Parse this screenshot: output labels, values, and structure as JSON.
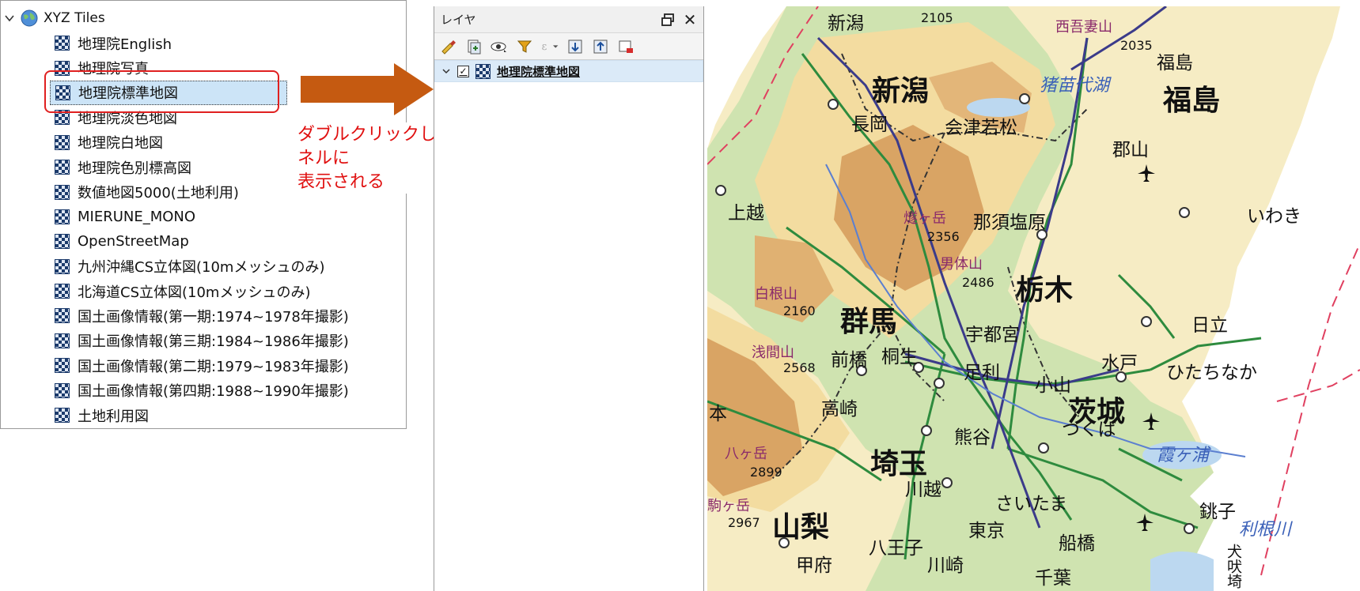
{
  "browser": {
    "root_label": "XYZ Tiles",
    "items": [
      {
        "label": "地理院English"
      },
      {
        "label": "地理院写真"
      },
      {
        "label": "地理院標準地図",
        "selected": true
      },
      {
        "label": "地理院淡色地図"
      },
      {
        "label": "地理院白地図"
      },
      {
        "label": "地理院色別標高図"
      },
      {
        "label": "数値地図5000(土地利用)"
      },
      {
        "label": "MIERUNE_MONO"
      },
      {
        "label": "OpenStreetMap"
      },
      {
        "label": "九州沖縄CS立体図(10mメッシュのみ)"
      },
      {
        "label": "北海道CS立体図(10mメッシュのみ)"
      },
      {
        "label": "国土画像情報(第一期:1974~1978年撮影)"
      },
      {
        "label": "国土画像情報(第三期:1984~1986年撮影)"
      },
      {
        "label": "国土画像情報(第二期:1979~1983年撮影)"
      },
      {
        "label": "国土画像情報(第四期:1988~1990年撮影)"
      },
      {
        "label": "土地利用図"
      }
    ]
  },
  "callout": {
    "line1": "ダブルクリックしたタイルが、レイヤパネルに",
    "line2": "表示される",
    "color": "#e01010",
    "arrow_color": "#c55a11"
  },
  "layers_panel": {
    "title": "レイヤ",
    "toolbar_icons": [
      "style-icon",
      "add-group-icon",
      "visibility-icon",
      "filter-icon",
      "expression-filter-icon",
      "expand-all-icon",
      "collapse-all-icon",
      "remove-layer-icon"
    ],
    "layers": [
      {
        "name": "地理院標準地図",
        "checked": true
      }
    ]
  },
  "map": {
    "prefectures": [
      "新潟",
      "福島",
      "群馬",
      "栃木",
      "茨城",
      "埼玉",
      "山梨"
    ],
    "cities": [
      "新潟",
      "長岡",
      "会津若松",
      "福島",
      "郡山",
      "上越",
      "那須塩原",
      "いわき",
      "宇都宮",
      "日立",
      "前橋",
      "桐生",
      "足利",
      "水戸",
      "ひたちなか",
      "高崎",
      "小山",
      "熊谷",
      "つくば",
      "川越",
      "さいたま",
      "東京",
      "船橋",
      "銚子",
      "甲府",
      "八王子",
      "川崎",
      "千葉",
      "本"
    ],
    "mountains": [
      {
        "name": "西吾妻山",
        "elev": "2035"
      },
      {
        "name": "燧ヶ岳",
        "elev": "2356"
      },
      {
        "name": "男体山",
        "elev": "2486"
      },
      {
        "name": "白根山",
        "elev": "2160"
      },
      {
        "name": "浅間山",
        "elev": "2568"
      },
      {
        "name": "八ヶ岳",
        "elev": "2899"
      },
      {
        "name": "駒ヶ岳",
        "elev": "2967"
      }
    ],
    "top_elev": "2105",
    "water": [
      "猪苗代湖",
      "霞ヶ浦",
      "利根川"
    ],
    "coast_label": "犬吠埼",
    "partial_label": "東京",
    "colors": {
      "lowland": "#cfe3b0",
      "upland": "#f3dca0",
      "mountain": "#d9a464",
      "sea": "#ffffff",
      "road": "#2e8b3e",
      "rail": "#3b3b8a"
    }
  }
}
